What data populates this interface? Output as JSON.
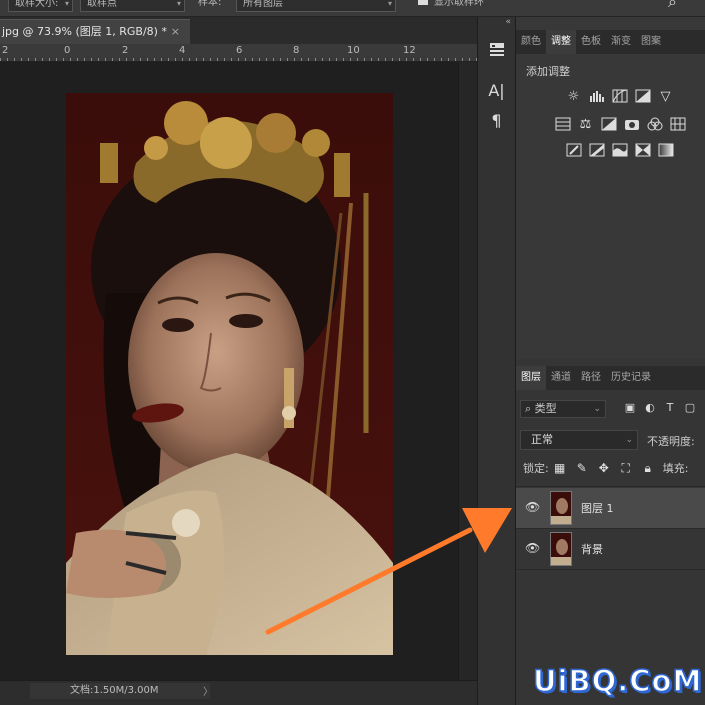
{
  "options_bar": {
    "dd1": "取样大小:",
    "dd2": "取样点",
    "label3": "样本:",
    "dd3": "所有图层",
    "checkbox_label": "显示取样环"
  },
  "document": {
    "tab_title": "jpg @ 73.9% (图层 1, RGB/8) *",
    "close_glyph": "×"
  },
  "ruler": {
    "labels": [
      "2",
      "0",
      "2",
      "4",
      "6",
      "8",
      "10",
      "12"
    ]
  },
  "status_bar": {
    "doc_info": "文档:1.50M/3.00M",
    "arrow": "〉"
  },
  "tool_column": {
    "collapse": "«",
    "char_icon": "A|",
    "para_icon": "¶"
  },
  "top_panel": {
    "tabs": [
      "颜色",
      "调整",
      "色板",
      "渐变",
      "图案"
    ],
    "active_tab": "调整",
    "title": "添加调整"
  },
  "layers_panel": {
    "tabs": [
      "图层",
      "通道",
      "路径",
      "历史记录"
    ],
    "active_tab": "图层",
    "kind_filter": "类型",
    "blend_mode": "正常",
    "opacity_label": "不透明度:",
    "lock_label": "锁定:",
    "fill_label": "填充:",
    "layers": [
      {
        "name": "图层 1",
        "selected": true,
        "visible": true
      },
      {
        "name": "背景",
        "selected": false,
        "visible": true
      }
    ]
  },
  "annotation": {
    "arrow_color": "#ff7a2a"
  },
  "watermark": {
    "text": "UiBQ.CoM"
  }
}
